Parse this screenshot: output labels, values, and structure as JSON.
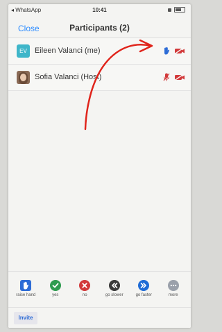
{
  "status_bar": {
    "back_app": "◂ WhatsApp",
    "time": "10:41"
  },
  "header": {
    "close_label": "Close",
    "title": "Participants (2)"
  },
  "participants": [
    {
      "initials": "EV",
      "name": "Eileen Valanci (me)",
      "hand_raised": true,
      "mic_muted": false,
      "video_off": true
    },
    {
      "initials": "",
      "name": "Sofia Valanci (Host)",
      "hand_raised": false,
      "mic_muted": true,
      "video_off": true
    }
  ],
  "reactions": [
    {
      "icon": "raise-hand-icon",
      "label": "raise hand",
      "color": "#2d6cd6"
    },
    {
      "icon": "check-icon",
      "label": "yes",
      "color": "#2e9b4f"
    },
    {
      "icon": "x-icon",
      "label": "no",
      "color": "#d2393a"
    },
    {
      "icon": "rewind-icon",
      "label": "go slower",
      "color": "#3a3a3a"
    },
    {
      "icon": "fast-forward-icon",
      "label": "go faster",
      "color": "#1e6bd6"
    },
    {
      "icon": "more-icon",
      "label": "more",
      "color": "#9aa0aa"
    }
  ],
  "footer": {
    "invite_label": "Invite"
  },
  "colors": {
    "accent": "#2d8cff",
    "annotation": "#e0241b"
  }
}
